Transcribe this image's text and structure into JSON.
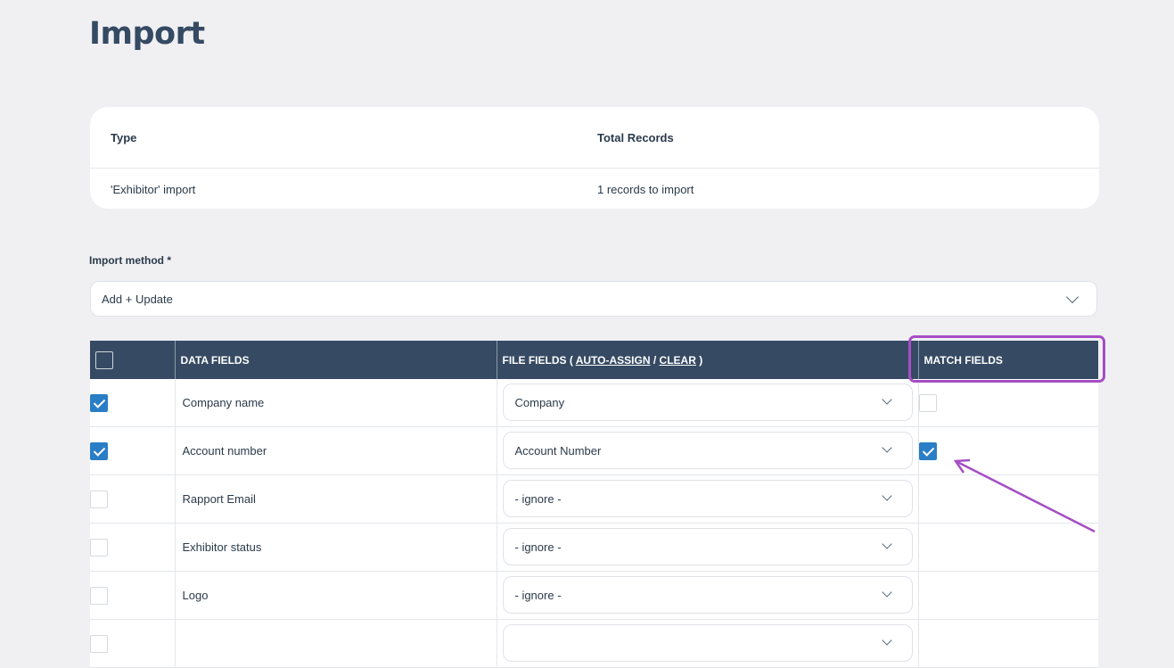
{
  "page": {
    "title": "Import"
  },
  "summary": {
    "headers": {
      "type": "Type",
      "total": "Total Records"
    },
    "values": {
      "type": "'Exhibitor' import",
      "total": "1 records to import"
    }
  },
  "import_method": {
    "label": "Import method *",
    "value": "Add + Update"
  },
  "table": {
    "headers": {
      "data_fields": "DATA FIELDS",
      "file_fields_prefix": "FILE FIELDS ( ",
      "auto_assign": "AUTO-ASSIGN",
      "sep": " / ",
      "clear": "CLEAR",
      "file_fields_suffix": " )",
      "match_fields": "MATCH FIELDS"
    },
    "rows": [
      {
        "checked": true,
        "label": "Company name",
        "file_field": "Company",
        "match": "unchecked"
      },
      {
        "checked": true,
        "label": "Account number",
        "file_field": "Account Number",
        "match": "checked"
      },
      {
        "checked": false,
        "label": "Rapport Email",
        "file_field": "- ignore -",
        "match": "none"
      },
      {
        "checked": false,
        "label": "Exhibitor status",
        "file_field": "- ignore -",
        "match": "none"
      },
      {
        "checked": false,
        "label": "Logo",
        "file_field": "- ignore -",
        "match": "none"
      },
      {
        "checked": false,
        "label": "",
        "file_field": "",
        "match": "none"
      }
    ]
  },
  "colors": {
    "header_bg": "#364a63",
    "checkbox_blue": "#2a7ec5",
    "annotation": "#a64ec4",
    "page_bg": "#f0f0f3"
  }
}
